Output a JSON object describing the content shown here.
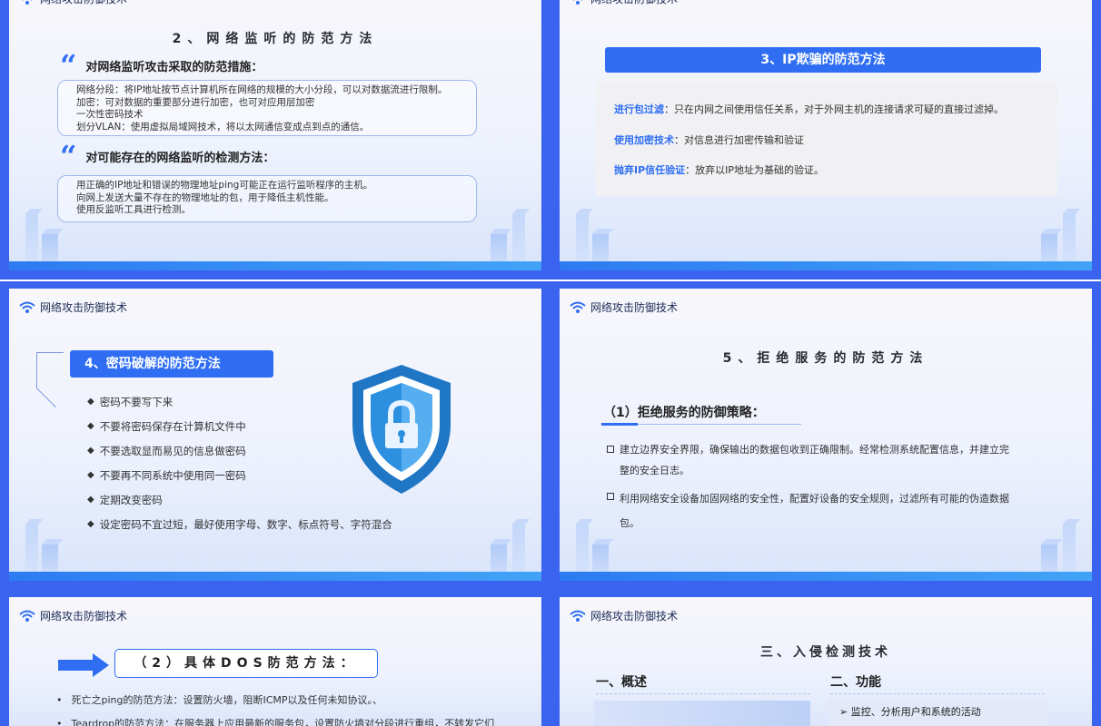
{
  "brand": {
    "name": "网络攻击防御技术"
  },
  "colors": {
    "accent": "#2f6ef2",
    "frame": "#3a63ef"
  },
  "slide1": {
    "title": "2、网络监听的防范方法",
    "heading1": "对网络监听攻击采取的防范措施：",
    "box1": [
      "网络分段：将IP地址按节点计算机所在网络的规模的大小分段，可以对数据流进行限制。",
      "加密：可对数据的重要部分进行加密，也可对应用层加密",
      "一次性密码技术",
      "划分VLAN：使用虚拟局域网技术，将以太网通信变成点到点的通信。"
    ],
    "heading2": "对可能存在的网络监听的检测方法：",
    "box2": [
      "用正确的IP地址和错误的物理地址ping可能正在运行监听程序的主机。",
      "向网上发送大量不存在的物理地址的包，用于降低主机性能。",
      "使用反监听工具进行检测。"
    ]
  },
  "slide2": {
    "title": "3、IP欺骗的防范方法",
    "items": [
      {
        "key": "进行包过滤",
        "text": "：只在内网之间使用信任关系，对于外网主机的连接请求可疑的直接过滤掉。"
      },
      {
        "key": "使用加密技术",
        "text": "：对信息进行加密传输和验证"
      },
      {
        "key": "抛弃IP信任验证",
        "text": "：放弃以IP地址为基础的验证。"
      }
    ]
  },
  "slide3": {
    "title": "4、密码破解的防范方法",
    "items": [
      "密码不要写下来",
      "不要将密码保存在计算机文件中",
      "不要选取显而易见的信息做密码",
      "不要再不同系统中使用同一密码",
      "定期改变密码",
      "设定密码不宜过短，最好使用字母、数字、标点符号、字符混合"
    ]
  },
  "slide4": {
    "title": "5、拒绝服务的防范方法",
    "subtitle": "（1）拒绝服务的防御策略：",
    "items": [
      [
        "建立边界安全界限，确保输出的数据包收到正确限制。经常检测系统配置信息，并建立完",
        "整的安全日志。"
      ],
      [
        "利用网络安全设备加固网络的安全性，配置好设备的安全规则，过滤所有可能的伪造数据",
        "包。"
      ]
    ]
  },
  "slide5": {
    "title": "（2）具体DOS防范方法：",
    "items": [
      "死亡之ping的防范方法：设置防火墙，阻断ICMP以及任何未知协议。、",
      "Teardrop的防范方法：在服务器上应用最新的服务包，设置防火墙对分段进行重组，不转发它们"
    ]
  },
  "slide6": {
    "title": "三、入侵检测技术",
    "col1": "一、概述",
    "col2": "二、功能",
    "func1": "监控、分析用户和系统的活动"
  }
}
